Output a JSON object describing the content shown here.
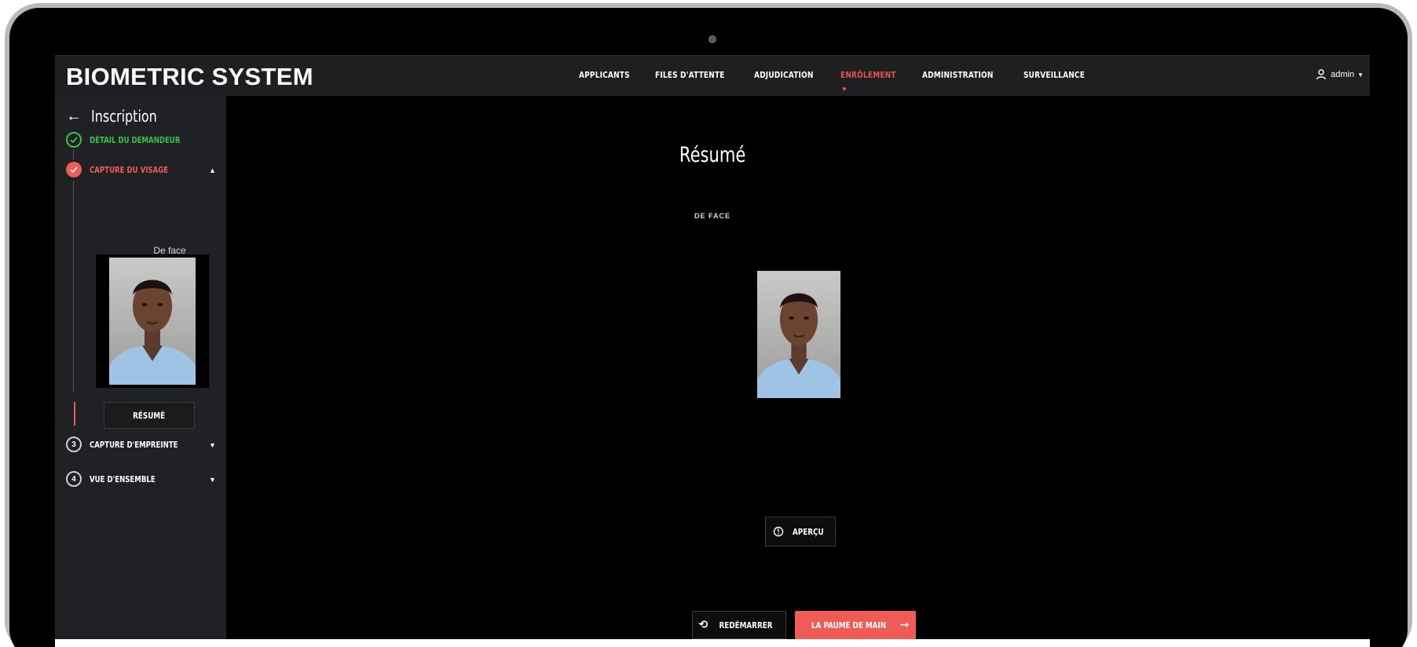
{
  "app": {
    "title": "BIOMETRIC SYSTEM"
  },
  "nav": {
    "items": [
      "APPLICANTS",
      "FILES D'ATTENTE",
      "ADJUDICATION",
      "ENRÔLEMENT",
      "ADMINISTRATION",
      "SURVEILLANCE"
    ],
    "active": "ENRÔLEMENT",
    "accent_color": "#e9534c"
  },
  "user": {
    "name": "admin",
    "icon": "user-icon"
  },
  "sidebar": {
    "back_title": "Inscription",
    "steps": [
      {
        "label": "DÉTAIL DU DEMANDEUR",
        "state": "done",
        "color": "#39c24b"
      },
      {
        "label": "CAPTURE DU VISAGE",
        "state": "active-error",
        "color": "#ef5c55"
      },
      {
        "label": "CAPTURE D'EMPREINTE",
        "number": "3",
        "state": "pending"
      },
      {
        "label": "VUE D'ENSEMBLE",
        "number": "4",
        "state": "pending"
      }
    ],
    "face_label": "De face",
    "resume_label": "RÉSUMÉ"
  },
  "main": {
    "title": "Résumé",
    "sub_label": "DE FACE",
    "apercu_label": "APERÇU",
    "restart_label": "REDÉMARRER",
    "next_label": "LA PAUME DE MAIN"
  }
}
